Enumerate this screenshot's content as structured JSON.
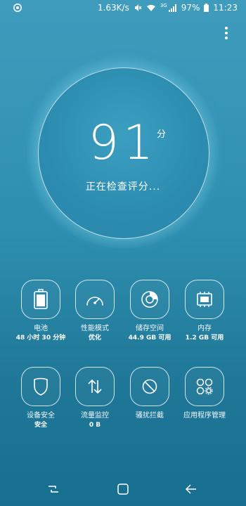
{
  "status_bar": {
    "speed": "1.63K/s",
    "network": "3G",
    "battery": "97%",
    "time": "11:23",
    "icons": [
      "sync-icon",
      "mute-icon",
      "wifi-icon",
      "signal-icon",
      "battery-icon"
    ]
  },
  "header": {
    "menu_icon": "more-vert-icon"
  },
  "score": {
    "value": "91",
    "unit": "分",
    "status": "正在检查评分..."
  },
  "tiles": [
    {
      "icon": "battery-icon",
      "label": "电池",
      "sub": "48 小时 30 分钟"
    },
    {
      "icon": "speedometer-icon",
      "label": "性能模式",
      "sub": "优化"
    },
    {
      "icon": "storage-icon",
      "label": "储存空间",
      "sub": "44.9 GB 可用"
    },
    {
      "icon": "chip-icon",
      "label": "内存",
      "sub": "1.2 GB 可用"
    },
    {
      "icon": "shield-icon",
      "label": "设备安全",
      "sub": "安全"
    },
    {
      "icon": "data-transfer-icon",
      "label": "流量监控",
      "sub": "0 B"
    },
    {
      "icon": "block-icon",
      "label": "骚扰拦截",
      "sub": ""
    },
    {
      "icon": "apps-gear-icon",
      "label": "应用程序管理",
      "sub": ""
    }
  ],
  "nav": {
    "recents": "recents-icon",
    "home": "home-icon",
    "back": "back-icon"
  }
}
